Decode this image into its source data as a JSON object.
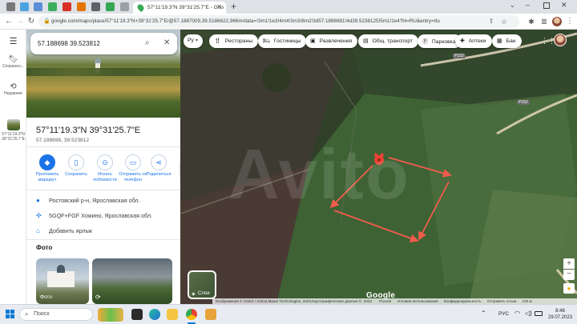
{
  "browser": {
    "tab_title": "57°11'19.3\"N 39°31'25.7\"E - Goo",
    "new_tab": "+",
    "url": "google.com/maps/place/57°11'19.3\"N+39°31'25.7\"E/@57.1887009,39.5186622,966m/data=!3m1!1e3!4m4!3m3!8m2!3d57.1886981!4d39.5238125!5m1!1e4?hl=RU&entry=ttu"
  },
  "rail": {
    "saved": "Сохранен...",
    "recent": "Недавние",
    "recent_place": "57°11'19.3\"N 39°31'25.7\"E"
  },
  "search": {
    "value": "57.188698 39.523812"
  },
  "place": {
    "title": "57°11'19.3\"N 39°31'25.7\"E",
    "subtitle": "57.188698, 39.523812",
    "actions": [
      {
        "icon": "route",
        "label": "Проложить маршрут"
      },
      {
        "icon": "bookmark",
        "label": "Сохранить"
      },
      {
        "icon": "nearby",
        "label": "Искать поблизости"
      },
      {
        "icon": "phone",
        "label": "Отправить на телефон"
      },
      {
        "icon": "share",
        "label": "Поделиться"
      }
    ],
    "region": "Ростовский р-н, Ярославская обл.",
    "plus_code": "5GQF+FGF Хожино, Ярославская обл.",
    "add_label": "Добавить ярлык",
    "photos_heading": "Фото",
    "photo_label": "Фото"
  },
  "map": {
    "filters": [
      "Рестораны",
      "Гостиницы",
      "Развлечения",
      "Общ. транспорт",
      "Парковка",
      "Аптеки",
      "Бан"
    ],
    "lang_button": "Ру",
    "layers_label": "Слои",
    "road_labels": [
      "Р152",
      "Р152"
    ],
    "logo": "Google",
    "attribution": "Изображения © CNES / Airbus,Maxar Technologies, 2023,Картографические данные ©, 2023",
    "footer_links": [
      "Россия",
      "Условия использования",
      "Конфиденциальность",
      "Отправить отзыв",
      "100 м"
    ],
    "watermark": "Avito"
  },
  "taskbar": {
    "search_placeholder": "Поиск",
    "language": "РУС",
    "time": "8:48",
    "date": "29.07.2023"
  },
  "colors": {
    "accent": "#1a73e8",
    "pin": "#ea4335",
    "arrows": "#f25c4d"
  }
}
